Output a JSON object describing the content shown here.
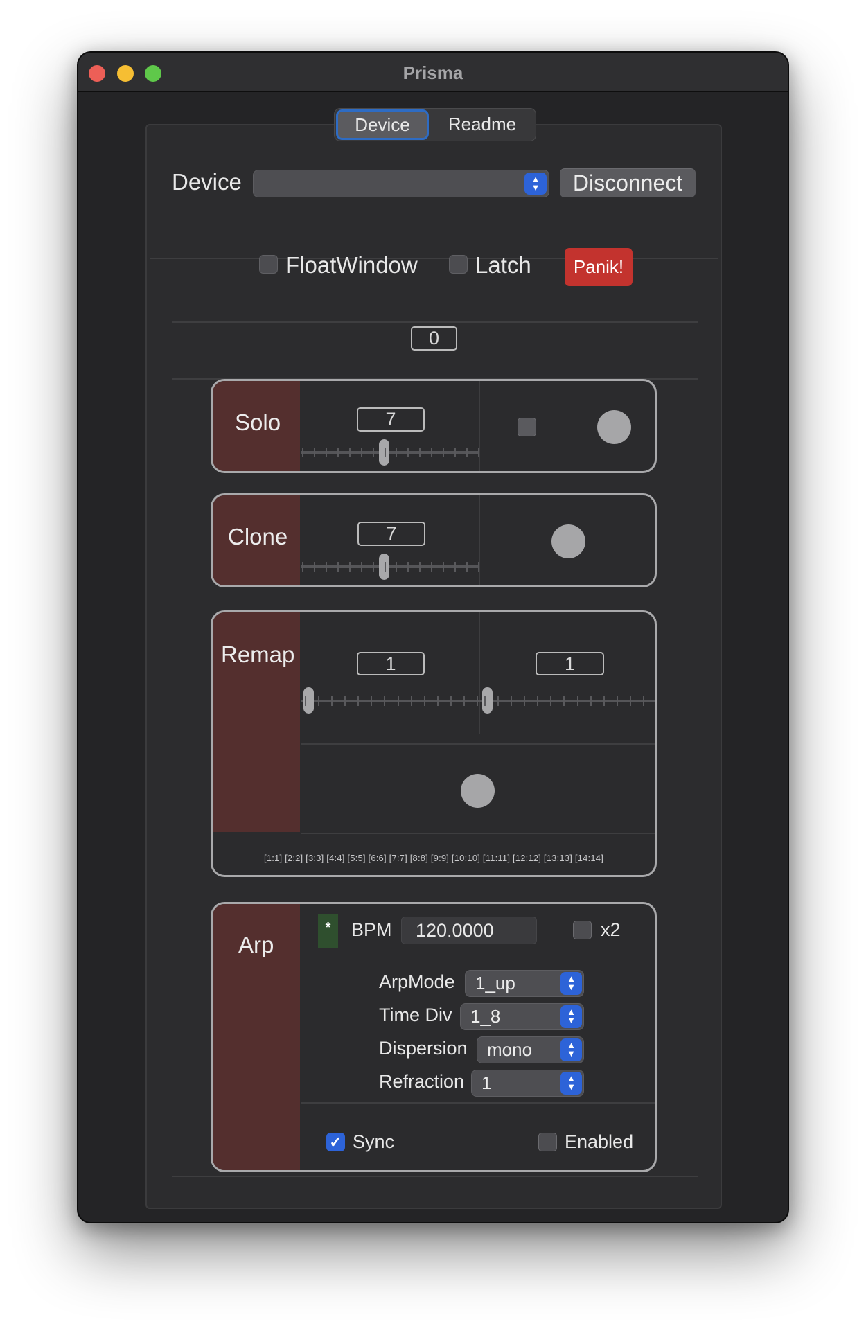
{
  "window": {
    "title": "Prisma"
  },
  "tabs": [
    {
      "label": "Device",
      "selected": true
    },
    {
      "label": "Readme",
      "selected": false
    }
  ],
  "device": {
    "label": "Device",
    "selected_value": "",
    "disconnect_label": "Disconnect"
  },
  "options": {
    "floatwindow_label": "FloatWindow",
    "floatwindow_checked": false,
    "latch_label": "Latch",
    "latch_checked": false,
    "panik_label": "Panik!"
  },
  "counter": {
    "value": "0"
  },
  "solo": {
    "title": "Solo",
    "value": "7",
    "slider_value": 7,
    "checkbox_checked": false
  },
  "clone": {
    "title": "Clone",
    "value": "7",
    "slider_value": 7
  },
  "remap": {
    "title": "Remap",
    "value_left": "1",
    "value_right": "1",
    "mapping": "[1:1] [2:2] [3:3] [4:4] [5:5] [6:6] [7:7] [8:8] [9:9] [10:10] [11:11] [12:12] [13:13] [14:14]"
  },
  "arp": {
    "title": "Arp",
    "star": "*",
    "bpm_label": "BPM",
    "bpm_value": "120.0000",
    "x2_label": "x2",
    "x2_checked": false,
    "arpmode_label": "ArpMode",
    "arpmode_value": "1_up",
    "timediv_label": "Time Div",
    "timediv_value": "1_8",
    "dispersion_label": "Dispersion",
    "dispersion_value": "mono",
    "refraction_label": "Refraction",
    "refraction_value": "1",
    "sync_label": "Sync",
    "sync_checked": true,
    "enabled_label": "Enabled",
    "enabled_checked": false
  },
  "colors": {
    "panel_side": "#542f2e",
    "panik": "#c3332e",
    "accent": "#2d63d8"
  }
}
